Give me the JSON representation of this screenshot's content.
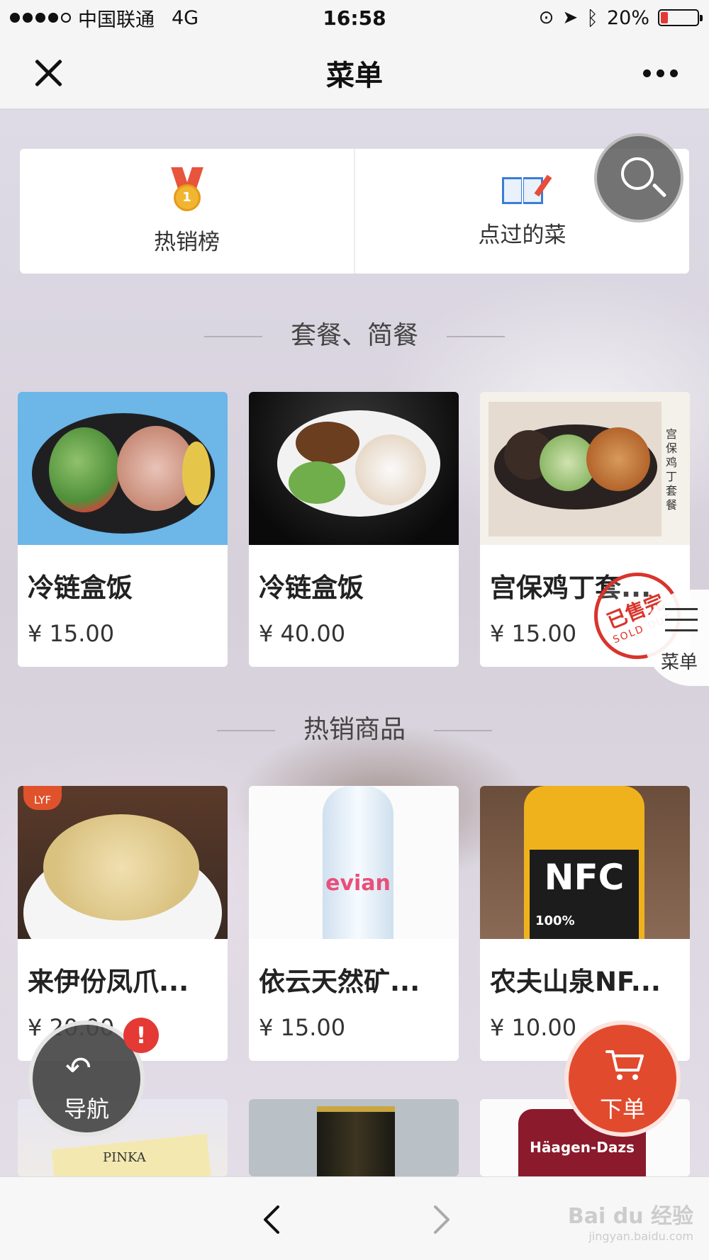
{
  "status_bar": {
    "carrier": "中国联通",
    "network": "4G",
    "time": "16:58",
    "battery": "20%",
    "battery_level": 0.2
  },
  "nav": {
    "title": "菜单",
    "close_icon": "close-icon",
    "more_icon": "more-icon"
  },
  "quick_links": [
    {
      "label": "热销榜",
      "icon": "medal-icon"
    },
    {
      "label": "点过的菜",
      "icon": "book-icon"
    }
  ],
  "sections": [
    {
      "title": "套餐、简餐",
      "items": [
        {
          "name": "冷链盒饭",
          "price": "¥ 15.00"
        },
        {
          "name": "冷链盒饭",
          "price": "¥ 40.00"
        },
        {
          "name": "宫保鸡丁套...",
          "price": "¥ 15.00",
          "sold_out": true
        }
      ]
    },
    {
      "title": "热销商品",
      "items": [
        {
          "name": "来伊份凤爪...",
          "price": "¥ 20.00"
        },
        {
          "name": "依云天然矿...",
          "price": "¥ 15.00"
        },
        {
          "name": "农夫山泉NF...",
          "price": "¥ 10.00"
        }
      ]
    }
  ],
  "sold_out_stamp": {
    "cn": "已售完",
    "en": "SOLD OUT"
  },
  "side_menu": {
    "label": "菜单"
  },
  "fab_nav": {
    "label": "导航",
    "badge": "!"
  },
  "fab_order": {
    "label": "下单"
  },
  "image_text": {
    "lyf": "LYF",
    "evian": "evian",
    "nfc": "NFC",
    "nfc_percent": "100%",
    "pinka": "PINKA",
    "haagen": "Häagen-Dazs",
    "gongbao_label": "宫保鸡丁套餐"
  },
  "watermark": {
    "main": "Bai du 经验",
    "sub": "jingyan.baidu.com"
  },
  "colors": {
    "accent": "#e24a2d",
    "badge": "#e53935",
    "stamp": "#d9342b"
  }
}
